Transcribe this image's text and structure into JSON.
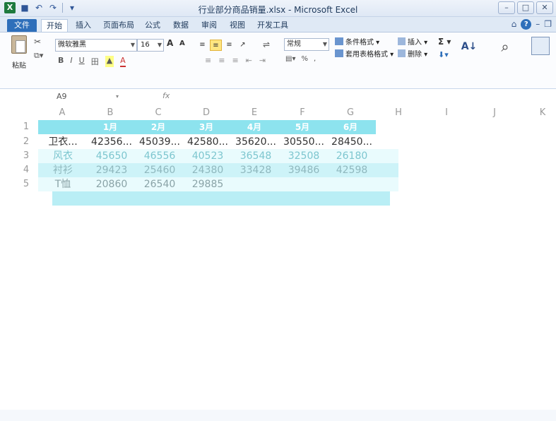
{
  "window": {
    "title": "行业部分商品销量.xlsx - Microsoft Excel",
    "app_icon": "X"
  },
  "tabs": [
    {
      "label": "文件"
    },
    {
      "label": "开始"
    },
    {
      "label": "插入"
    },
    {
      "label": "页面布局"
    },
    {
      "label": "公式"
    },
    {
      "label": "数据"
    },
    {
      "label": "审阅"
    },
    {
      "label": "视图"
    },
    {
      "label": "开发工具"
    }
  ],
  "ribbon": {
    "paste_label": "粘贴",
    "font_name": "微软雅黑",
    "font_size": "16",
    "grow_font": "A",
    "shrink_font": "A",
    "number_format": "常规",
    "conditional_format": "条件格式",
    "table_format": "套用表格格式",
    "insert": "插入",
    "delete": "删除",
    "sum": "Σ"
  },
  "formula_bar": {
    "name_box": "A9",
    "fx": "fx"
  },
  "grid": {
    "columns": [
      "A",
      "B",
      "C",
      "D",
      "E",
      "F",
      "G",
      "H",
      "I",
      "J",
      "K"
    ],
    "rows": [
      "1",
      "2",
      "3",
      "4",
      "5"
    ],
    "header_row": [
      "",
      "1月",
      "2月",
      "3月",
      "4月",
      "5月",
      "6月"
    ],
    "data": [
      [
        "卫衣...",
        "42356...",
        "45039...",
        "42580...",
        "35620...",
        "30550...",
        "28450..."
      ],
      [
        "风衣",
        "45650",
        "46556",
        "40523",
        "36548",
        "32508",
        "26180"
      ],
      [
        "衬衫",
        "29423",
        "25460",
        "24380",
        "33428",
        "39486",
        "42598"
      ],
      [
        "T恤",
        "20860",
        "26540",
        "29885",
        "",
        "",
        ""
      ]
    ]
  },
  "colors": {
    "header_band": "#8de3ee",
    "band_light": "#cdf3f8",
    "excel_green": "#1f7a3e",
    "file_tab": "#2e6fba"
  }
}
